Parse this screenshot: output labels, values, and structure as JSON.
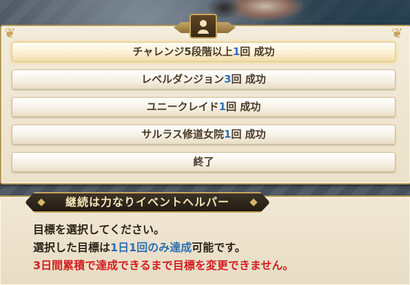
{
  "menu": {
    "options": [
      {
        "pre": "チャレンジ5段階以上",
        "num": "1",
        "post": "回 成功"
      },
      {
        "pre": "レベルダンジョン",
        "num": "3",
        "post": "回 成功"
      },
      {
        "pre": "ユニークレイド",
        "num": "1",
        "post": "回 成功"
      },
      {
        "pre": "サルラス修道女院",
        "num": "1",
        "post": "回 成功"
      },
      {
        "pre": "終了",
        "num": "",
        "post": ""
      }
    ],
    "emblem_icon": "person-bust-icon"
  },
  "dialog": {
    "title": "継続は力なりイベントヘルパー",
    "line1": "目標を選択してください。",
    "line2": {
      "pre": "選択した目標は",
      "highlight": "1日1回のみ達成",
      "post": "可能です。"
    },
    "line3": "3日間累積で達成できるまで目標を変更できません。"
  },
  "colors": {
    "accent_blue": "#2a6fb3",
    "warning_red": "#d02020",
    "panel_border": "#b59a5a"
  }
}
